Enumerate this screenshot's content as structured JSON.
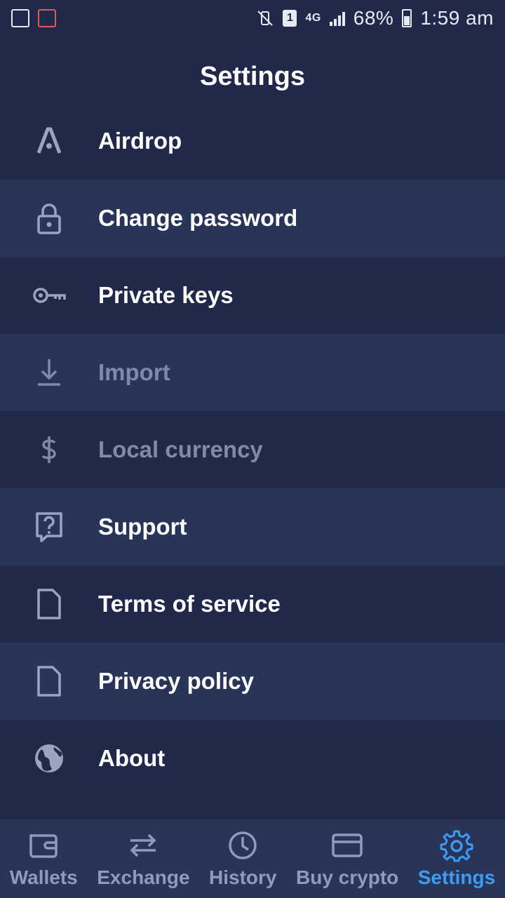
{
  "statusbar": {
    "sim_slot": "1",
    "network": "4G",
    "battery": "68%",
    "time": "1:59 am"
  },
  "header": {
    "title": "Settings"
  },
  "settings": [
    {
      "label": "Airdrop",
      "icon": "airdrop-icon",
      "enabled": true
    },
    {
      "label": "Change password",
      "icon": "lock-icon",
      "enabled": true
    },
    {
      "label": "Private keys",
      "icon": "key-icon",
      "enabled": true
    },
    {
      "label": "Import",
      "icon": "import-icon",
      "enabled": false
    },
    {
      "label": "Local currency",
      "icon": "dollar-icon",
      "enabled": false
    },
    {
      "label": "Support",
      "icon": "question-icon",
      "enabled": true
    },
    {
      "label": "Terms of service",
      "icon": "document-icon",
      "enabled": true
    },
    {
      "label": "Privacy policy",
      "icon": "document-icon",
      "enabled": true
    },
    {
      "label": "About",
      "icon": "globe-icon",
      "enabled": true
    }
  ],
  "tabs": [
    {
      "label": "Wallets",
      "icon": "wallet-icon",
      "active": false
    },
    {
      "label": "Exchange",
      "icon": "exchange-icon",
      "active": false
    },
    {
      "label": "History",
      "icon": "clock-icon",
      "active": false
    },
    {
      "label": "Buy crypto",
      "icon": "card-icon",
      "active": false
    },
    {
      "label": "Settings",
      "icon": "gear-icon",
      "active": true
    }
  ],
  "colors": {
    "background": "#20294a",
    "row_alt": "#283559",
    "text": "#ffffff",
    "disabled_text": "#7f8aa8",
    "icon": "#9aa4c2",
    "active_tab": "#3d9bf2",
    "inactive_tab": "#8f9bbd"
  }
}
